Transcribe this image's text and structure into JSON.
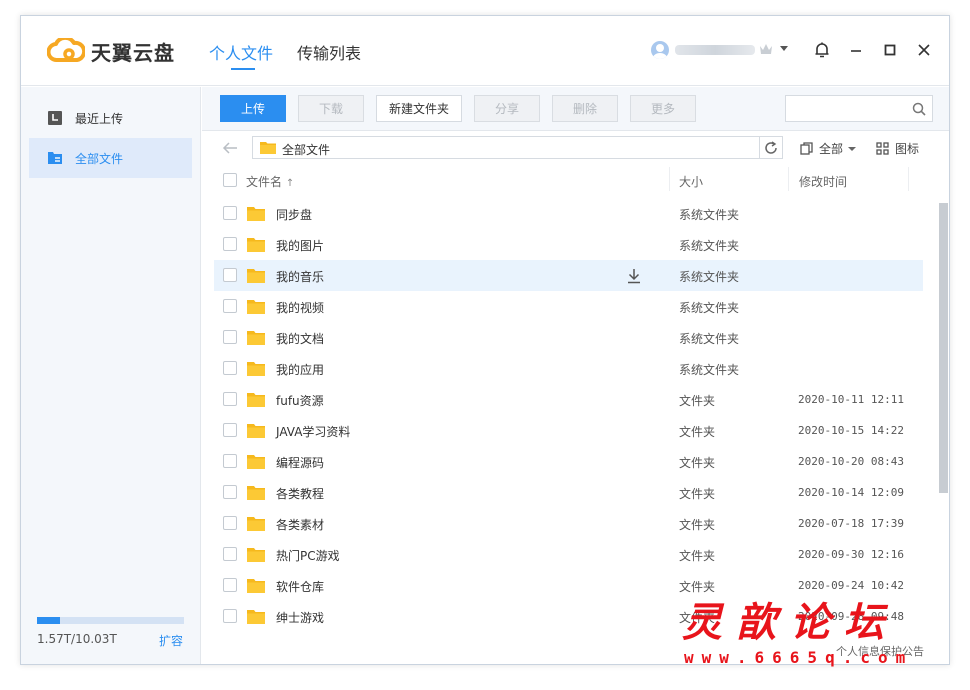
{
  "header": {
    "app_name": "天翼云盘",
    "tabs": [
      {
        "label": "个人文件",
        "active": true
      },
      {
        "label": "传输列表",
        "active": false
      }
    ],
    "accent_color": "#2b8ef0"
  },
  "sidebar": {
    "items": [
      {
        "label": "最近上传",
        "icon": "recent-upload-icon",
        "active": false
      },
      {
        "label": "全部文件",
        "icon": "all-files-icon",
        "active": true
      }
    ],
    "storage": {
      "text": "1.57T/10.03T",
      "used_fraction": 0.157,
      "expand_label": "扩容"
    }
  },
  "toolbar": {
    "upload": "上传",
    "download": "下载",
    "new_folder": "新建文件夹",
    "share": "分享",
    "delete": "删除",
    "more": "更多",
    "search_placeholder": ""
  },
  "pathbar": {
    "path": "全部文件",
    "filter_label": "全部",
    "view_label": "图标"
  },
  "table": {
    "columns": {
      "name": "文件名",
      "sort_indicator": "↑",
      "size": "大小",
      "modified": "修改时间"
    },
    "rows": [
      {
        "name": "同步盘",
        "size": "系统文件夹",
        "time": ""
      },
      {
        "name": "我的图片",
        "size": "系统文件夹",
        "time": ""
      },
      {
        "name": "我的音乐",
        "size": "系统文件夹",
        "time": "",
        "hover": true
      },
      {
        "name": "我的视频",
        "size": "系统文件夹",
        "time": ""
      },
      {
        "name": "我的文档",
        "size": "系统文件夹",
        "time": ""
      },
      {
        "name": "我的应用",
        "size": "系统文件夹",
        "time": ""
      },
      {
        "name": "fufu资源",
        "size": "文件夹",
        "time": "2020-10-11 12:11"
      },
      {
        "name": "JAVA学习资料",
        "size": "文件夹",
        "time": "2020-10-15 14:22"
      },
      {
        "name": "编程源码",
        "size": "文件夹",
        "time": "2020-10-20 08:43"
      },
      {
        "name": "各类教程",
        "size": "文件夹",
        "time": "2020-10-14 12:09"
      },
      {
        "name": "各类素材",
        "size": "文件夹",
        "time": "2020-07-18 17:39"
      },
      {
        "name": "热门PC游戏",
        "size": "文件夹",
        "time": "2020-09-30 12:16"
      },
      {
        "name": "软件仓库",
        "size": "文件夹",
        "time": "2020-09-24 10:42"
      },
      {
        "name": "绅士游戏",
        "size": "文件夹",
        "time": "2020-09-28 09:48"
      }
    ]
  },
  "footer": {
    "privacy": "个人信息保护公告"
  },
  "watermark": {
    "title": "灵歆论坛",
    "url": "www.6665q.com"
  }
}
